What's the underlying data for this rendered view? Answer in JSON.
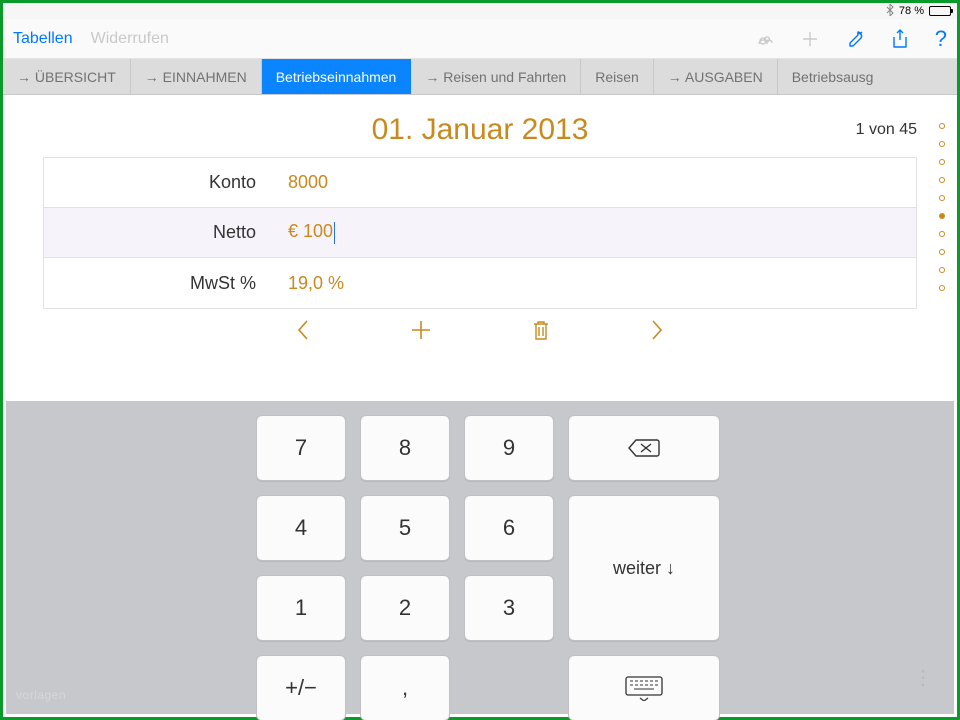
{
  "status": {
    "bluetooth": "✱",
    "battery_pct": "78 %"
  },
  "toolbar": {
    "tables": "Tabellen",
    "undo": "Widerrufen"
  },
  "tabs": [
    {
      "label": "→ ÜBERSICHT",
      "active": false
    },
    {
      "label": "→ EINNAHMEN",
      "active": false
    },
    {
      "label": "Betriebseinnahmen",
      "active": true
    },
    {
      "label": "→ Reisen und Fahrten",
      "active": false
    },
    {
      "label": "Reisen",
      "active": false
    },
    {
      "label": "→ AUSGABEN",
      "active": false
    },
    {
      "label": "Betriebsausg",
      "active": false
    }
  ],
  "header": {
    "date": "01. Januar 2013",
    "count": "1 von 45"
  },
  "form": {
    "konto_label": "Konto",
    "konto_value": "8000",
    "netto_label": "Netto",
    "netto_value": "€ 100",
    "mwst_label": "MwSt %",
    "mwst_value": "19,0 %"
  },
  "keypad": {
    "k7": "7",
    "k8": "8",
    "k9": "9",
    "k4": "4",
    "k5": "5",
    "k6": "6",
    "k1": "1",
    "k2": "2",
    "k3": "3",
    "pm": "+/−",
    "comma": ",",
    "next": "weiter ↓"
  },
  "watermark": "vorlagen"
}
